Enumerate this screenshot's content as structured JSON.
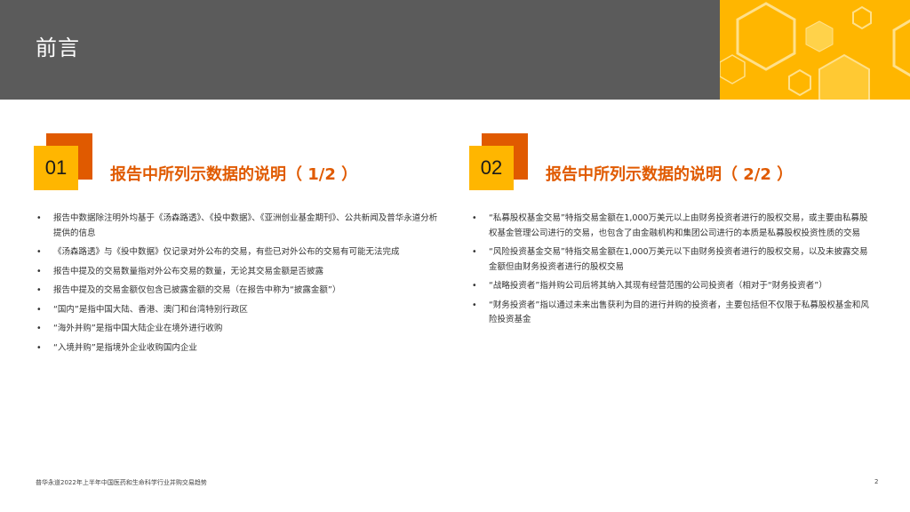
{
  "header": {
    "title": "前言"
  },
  "sections": [
    {
      "number": "01",
      "title": "报告中所列示数据的说明（ 1/2 ）",
      "bullets": [
        "报告中数据除注明外均基于《汤森路透》、《投中数据》、《亚洲创业基金期刊》、公共新闻及普华永道分析提供的信息",
        "《汤森路透》与《投中数据》仅记录对外公布的交易，有些已对外公布的交易有可能无法完成",
        "报告中提及的交易数量指对外公布交易的数量，无论其交易金额是否披露",
        "报告中提及的交易金额仅包含已披露金额的交易（在报告中称为“披露金额”）",
        "“国内”是指中国大陆、香港、澳门和台湾特别行政区",
        "“海外并购”是指中国大陆企业在境外进行收购",
        "“入境并购”是指境外企业收购国内企业"
      ]
    },
    {
      "number": "02",
      "title": "报告中所列示数据的说明（ 2/2 ）",
      "bullets": [
        "“私募股权基金交易”特指交易金额在1,000万美元以上由财务投资者进行的股权交易，或主要由私募股权基金管理公司进行的交易，也包含了由金融机构和集团公司进行的本质是私募股权投资性质的交易",
        "“风险投资基金交易”特指交易金额在1,000万美元以下由财务投资者进行的股权交易，以及未披露交易金额但由财务投资者进行的股权交易",
        "“战略投资者”指并购公司后将其纳入其现有经营范围的公司投资者（相对于“财务投资者”）",
        "“财务投资者”指以通过未来出售获利为目的进行并购的投资者，主要包括但不仅限于私募股权基金和风险投资基金"
      ]
    }
  ],
  "footer": {
    "text": "普华永道2022年上半年中国医药和生命科学行业并购交易趋势",
    "page": "2"
  },
  "colors": {
    "header_bg": "#5b5b5b",
    "accent_yellow": "#ffb600",
    "accent_orange": "#e05a00"
  }
}
